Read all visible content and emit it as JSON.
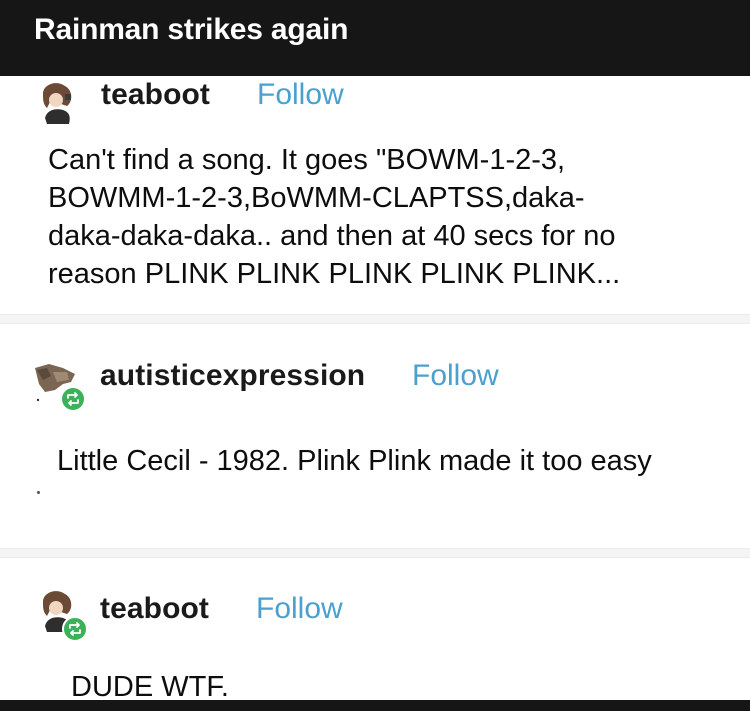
{
  "topbar": {
    "title": "Rainman strikes again"
  },
  "posts": [
    {
      "username": "teaboot",
      "follow_label": "Follow",
      "body": "Can't find a song. It goes \"BOWM-1-2-3,\nBOWMM-1-2-3,BoWMM-CLAPTSS,daka-\ndaka-daka-daka.. and then at 40 secs for no\nreason PLINK PLINK PLINK PLINK PLINK..."
    },
    {
      "username": "autisticexpression",
      "follow_label": "Follow",
      "body": "Little Cecil - 1982. Plink Plink made it too easy"
    },
    {
      "username": "teaboot",
      "follow_label": "Follow",
      "body": "DUDE WTF."
    }
  ],
  "colors": {
    "follow": "#4aa0cf",
    "reblog_badge": "#3bb15a",
    "bar": "#161616"
  }
}
